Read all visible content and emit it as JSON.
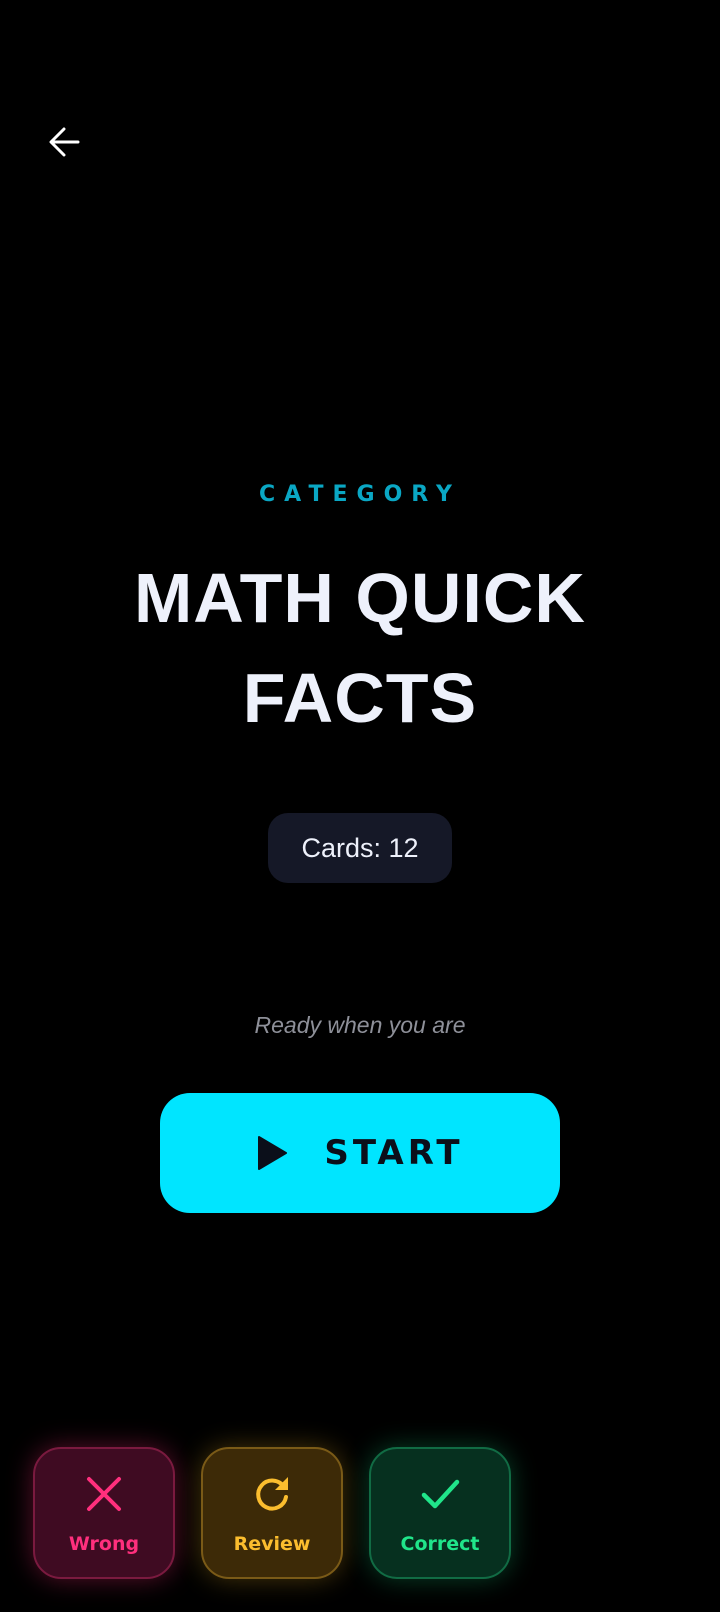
{
  "header": {
    "back_icon": "arrow-left-icon"
  },
  "category_label": "CATEGORY",
  "title": "MATH QUICK FACTS",
  "cards_badge": "Cards: 12",
  "prompt": "Ready when you are",
  "start_button": {
    "icon": "play-icon",
    "label": "START"
  },
  "rating_buttons": [
    {
      "label": "Wrong",
      "icon": "close-icon",
      "color": "#ff2f7d"
    },
    {
      "label": "Review",
      "icon": "refresh-icon",
      "color": "#fbbd2e"
    },
    {
      "label": "Correct",
      "icon": "check-icon",
      "color": "#20e58a"
    }
  ],
  "colors": {
    "background": "#000000",
    "accent": "#00e5ff",
    "category": "#0aa7c4"
  }
}
